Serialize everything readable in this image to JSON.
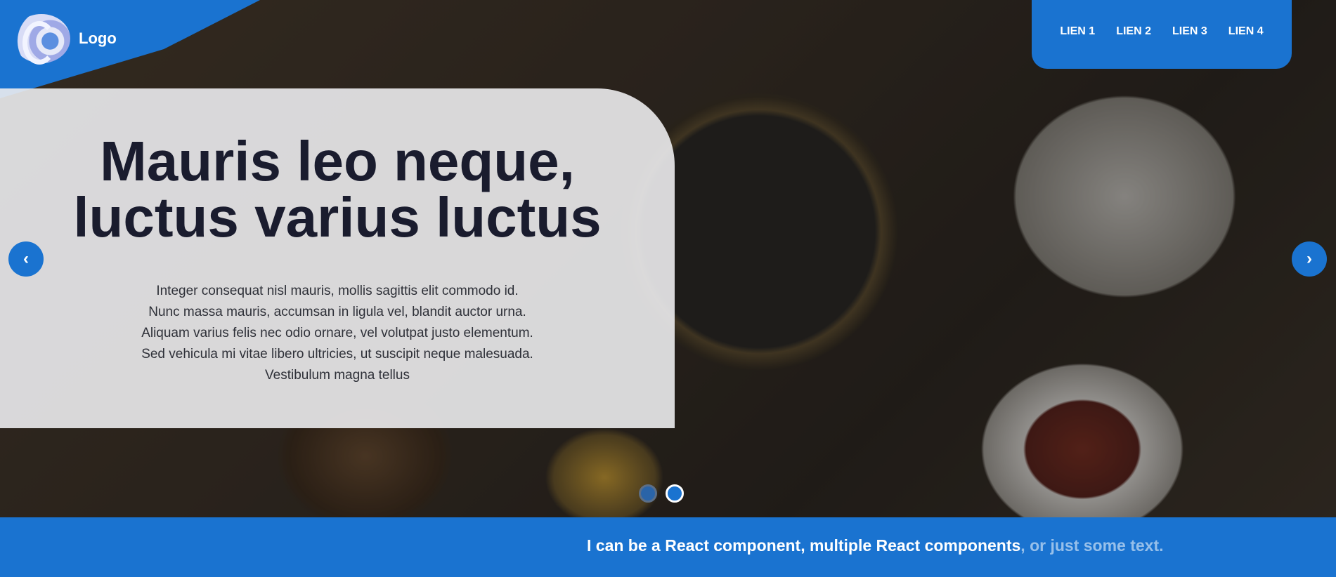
{
  "logo": {
    "text": "Logo"
  },
  "nav": {
    "links": [
      "LIEN 1",
      "LIEN 2",
      "LIEN 3",
      "LIEN 4"
    ]
  },
  "hero": {
    "title_line1": "Mauris leo neque,",
    "title_line2": "luctus varius luctus",
    "description": "Integer consequat nisl mauris, mollis sagittis elit commodo id. Nunc massa mauris, accumsan in ligula vel, blandit auctor urna. Aliquam varius felis nec odio ornare, vel volutpat justo elementum. Sed vehicula mi vitae libero ultricies, ut suscipit neque malesuada. Vestibulum magna tellus"
  },
  "carousel": {
    "prev_icon": "chevron-left-icon",
    "next_icon": "chevron-right-icon",
    "slide_count": 2,
    "active_slide": 2
  },
  "footer": {
    "text_main": "I can be a React component, multiple React components",
    "text_fade": ", or just some text."
  },
  "colors": {
    "accent": "#1a73d0",
    "title": "#1a1c2e"
  }
}
